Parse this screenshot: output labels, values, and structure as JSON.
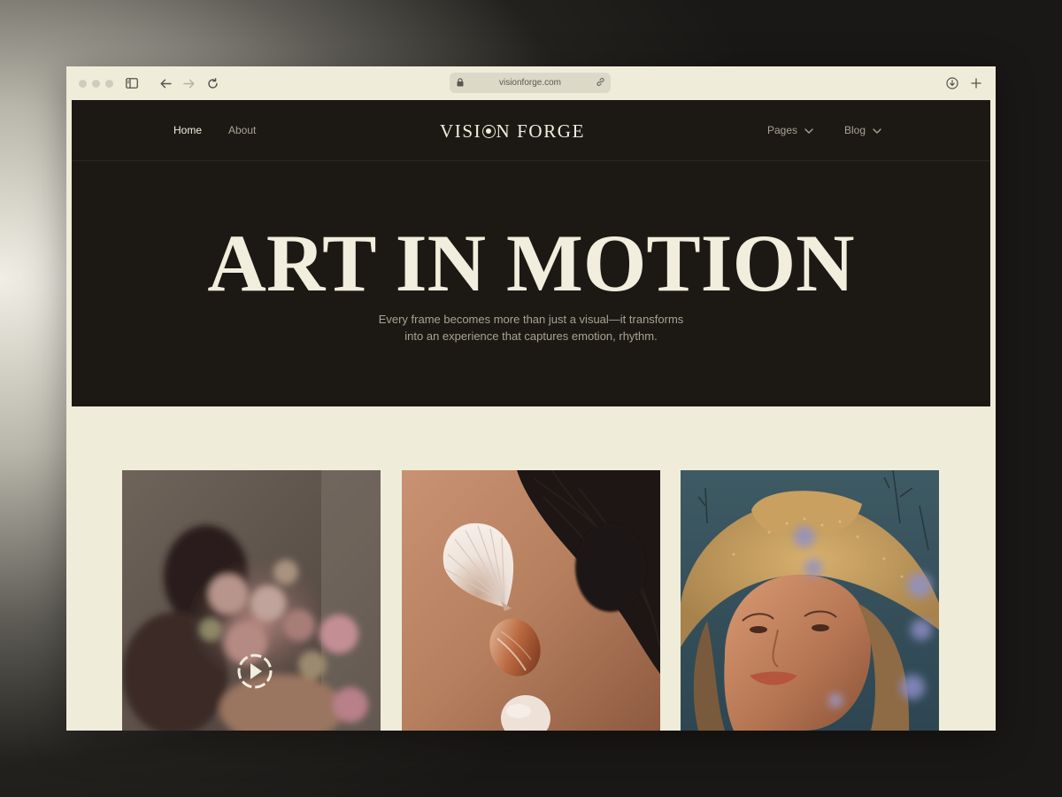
{
  "browser": {
    "url": "visionforge.com",
    "icons": [
      "sidebar-icon",
      "back-arrow-icon",
      "forward-arrow-icon",
      "reload-icon",
      "lock-icon",
      "link-icon",
      "download-icon",
      "plus-icon"
    ]
  },
  "nav": {
    "home": "Home",
    "about": "About",
    "logo_left": "VISI",
    "logo_right": "N FORGE",
    "pages": "Pages",
    "blog": "Blog"
  },
  "hero": {
    "title": "ART IN MOTION",
    "subtitle_line1": "Every frame becomes more than just a visual—it transforms",
    "subtitle_line2": "into an experience that captures emotion, rhythm."
  },
  "gallery": {
    "items": [
      {
        "subject": "woman-with-flowers-video",
        "has_play": true
      },
      {
        "subject": "seashells-on-skin",
        "has_play": false
      },
      {
        "subject": "woman-in-straw-hat",
        "has_play": false
      }
    ]
  },
  "colors": {
    "dark_bg": "#1c1915",
    "cream": "#efecda",
    "text_light": "#f1eedd",
    "text_muted": "#a8a391"
  }
}
